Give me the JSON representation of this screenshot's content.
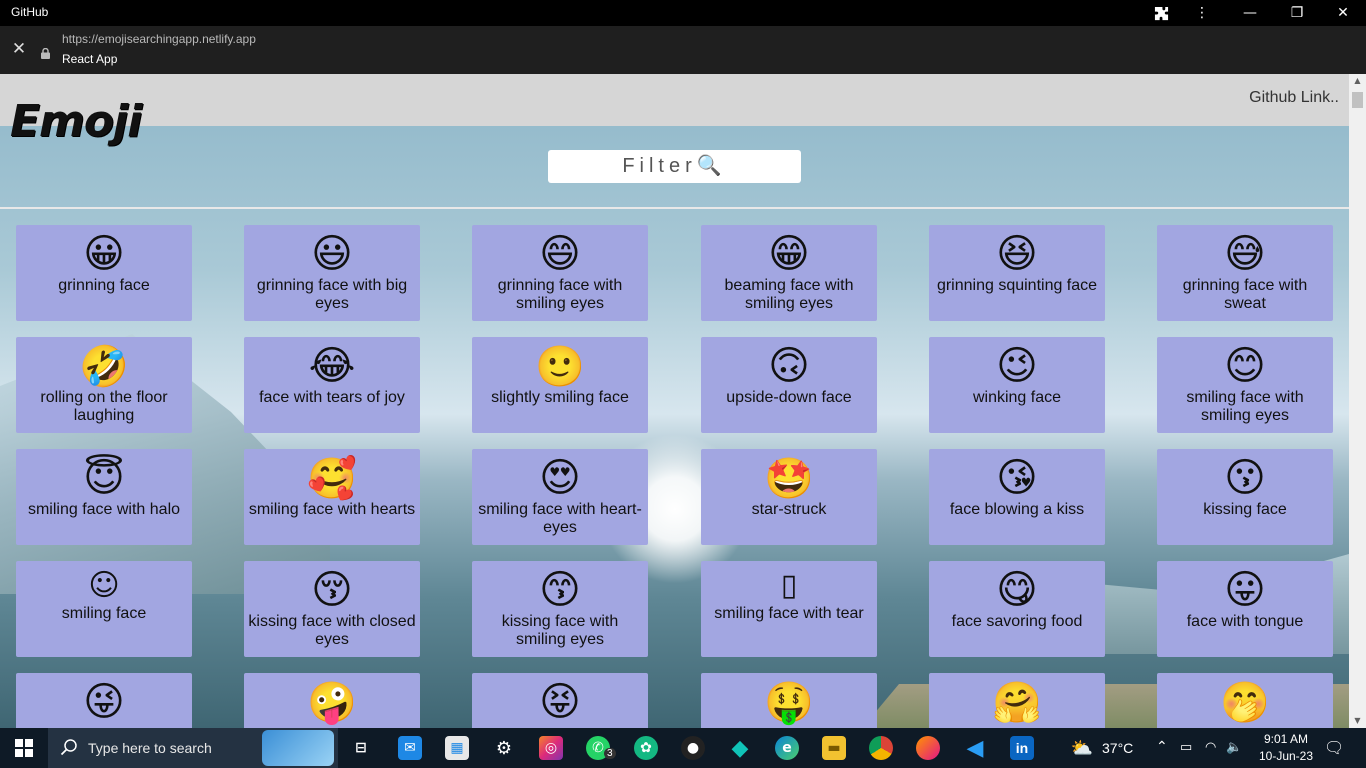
{
  "window": {
    "app_title": "GitHub",
    "url": "https://emojisearchingapp.netlify.app",
    "page_title": "React App"
  },
  "page": {
    "logo": "Emoji",
    "github_link": "Github Link..",
    "filter_placeholder": "Filter🔍"
  },
  "emojis": [
    {
      "name": "grinning face",
      "glyph": "😀"
    },
    {
      "name": "grinning face with big eyes",
      "glyph": "😃"
    },
    {
      "name": "grinning face with smiling eyes",
      "glyph": "😄"
    },
    {
      "name": "beaming face with smiling eyes",
      "glyph": "😁"
    },
    {
      "name": "grinning squinting face",
      "glyph": "😆"
    },
    {
      "name": "grinning face with sweat",
      "glyph": "😅"
    },
    {
      "name": "rolling on the floor laughing",
      "glyph": "🤣"
    },
    {
      "name": "face with tears of joy",
      "glyph": "😂"
    },
    {
      "name": "slightly smiling face",
      "glyph": "🙂"
    },
    {
      "name": "upside-down face",
      "glyph": "🙃"
    },
    {
      "name": "winking face",
      "glyph": "😉"
    },
    {
      "name": "smiling face with smiling eyes",
      "glyph": "😊"
    },
    {
      "name": "smiling face with halo",
      "glyph": "😇"
    },
    {
      "name": "smiling face with hearts",
      "glyph": "🥰"
    },
    {
      "name": "smiling face with heart-eyes",
      "glyph": "😍"
    },
    {
      "name": "star-struck",
      "glyph": "🤩"
    },
    {
      "name": "face blowing a kiss",
      "glyph": "😘"
    },
    {
      "name": "kissing face",
      "glyph": "😗"
    },
    {
      "name": "smiling face",
      "glyph": "☺"
    },
    {
      "name": "kissing face with closed eyes",
      "glyph": "😚"
    },
    {
      "name": "kissing face with smiling eyes",
      "glyph": "😙"
    },
    {
      "name": "smiling face with tear",
      "glyph": "▯"
    },
    {
      "name": "face savoring food",
      "glyph": "😋"
    },
    {
      "name": "face with tongue",
      "glyph": "😛"
    },
    {
      "name": "",
      "glyph": "😜"
    },
    {
      "name": "",
      "glyph": "🤪"
    },
    {
      "name": "",
      "glyph": "😝"
    },
    {
      "name": "",
      "glyph": "🤑"
    },
    {
      "name": "",
      "glyph": "🤗"
    },
    {
      "name": "",
      "glyph": "🤭"
    }
  ],
  "taskbar": {
    "search_placeholder": "Type here to search",
    "temperature": "37°C",
    "time": "9:01 AM",
    "date": "10-Jun-23",
    "whatsapp_badge": "3"
  }
}
